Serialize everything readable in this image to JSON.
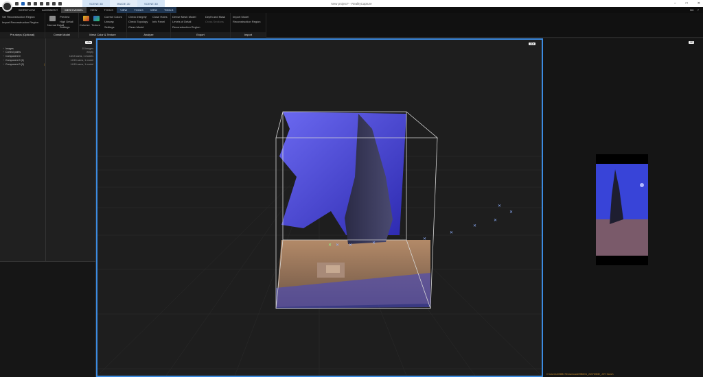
{
  "title_bar": {
    "tabs": [
      "SCENE 3D",
      "IMAGE 2D",
      "SCENE 3D"
    ],
    "window_title": "New project* - RealityCapture",
    "win_buttons": [
      "–",
      "□",
      "✕"
    ]
  },
  "menu": {
    "items": [
      "WORKFLOW",
      "ALIGNMENT",
      "MESH MODEL",
      "VIEW",
      "TOOLS",
      "VIEW",
      "TOOLS",
      "VIEW",
      "TOOLS"
    ],
    "right_icons": [
      "BC",
      "?"
    ]
  },
  "ribbon": {
    "preproc": {
      "set_region": "Set Reconstruction Region",
      "import_region": "Import Reconstruction Region",
      "label": "Pre-steps (Optional)"
    },
    "create": {
      "normal": "Normal Detail",
      "preview": "Preview",
      "high": "High Detail",
      "settings": "Settings",
      "label": "Create Model"
    },
    "color": {
      "colorize": "Colorize",
      "texture": "Texture",
      "correct": "Correct Colors",
      "unwrap": "Unwrap",
      "settings": "Settings",
      "label": "Mesh Color & Texture"
    },
    "analyze": {
      "check_integrity": "Check Integrity",
      "check_topology": "Check Topology",
      "clean": "Clean Model",
      "close_holes": "Close Holes",
      "info_panel": "Info Panel",
      "label": "Analyze"
    },
    "export": {
      "dense": "Dense Mesh Model",
      "lod": "Levels of Detail",
      "recon_region": "Reconstruction Region",
      "depth": "Depth and Mask",
      "cross": "Cross Sections",
      "label": "Export"
    },
    "import": {
      "import_model": "Import Model",
      "import_region": "Reconstruction Region",
      "label": "Import"
    }
  },
  "left_panel": {
    "btn": "1Ds",
    "rows": [
      {
        "name": "Images",
        "info": "15 images"
      },
      {
        "name": "Control points",
        "info": "empty"
      },
      {
        "name": "Component 0",
        "info": "14/15 cams, 1 models"
      },
      {
        "name": "Component 0 (1)",
        "info": "14/15 cams, 1 model"
      },
      {
        "name": "Component 0 (2)",
        "info": "14/15 cams, 1 model"
      }
    ]
  },
  "viewport": {
    "btn": "3Ds"
  },
  "right_panel": {
    "btn": "2D"
  },
  "status_path": "C:\\Users\\1098817\\Downloads\\RBM01_2497MMIE_JOY frame\\",
  "colors": {
    "accent": "#3c8be0",
    "ground": "#8a6a4e",
    "sky": "#4d4be0"
  }
}
